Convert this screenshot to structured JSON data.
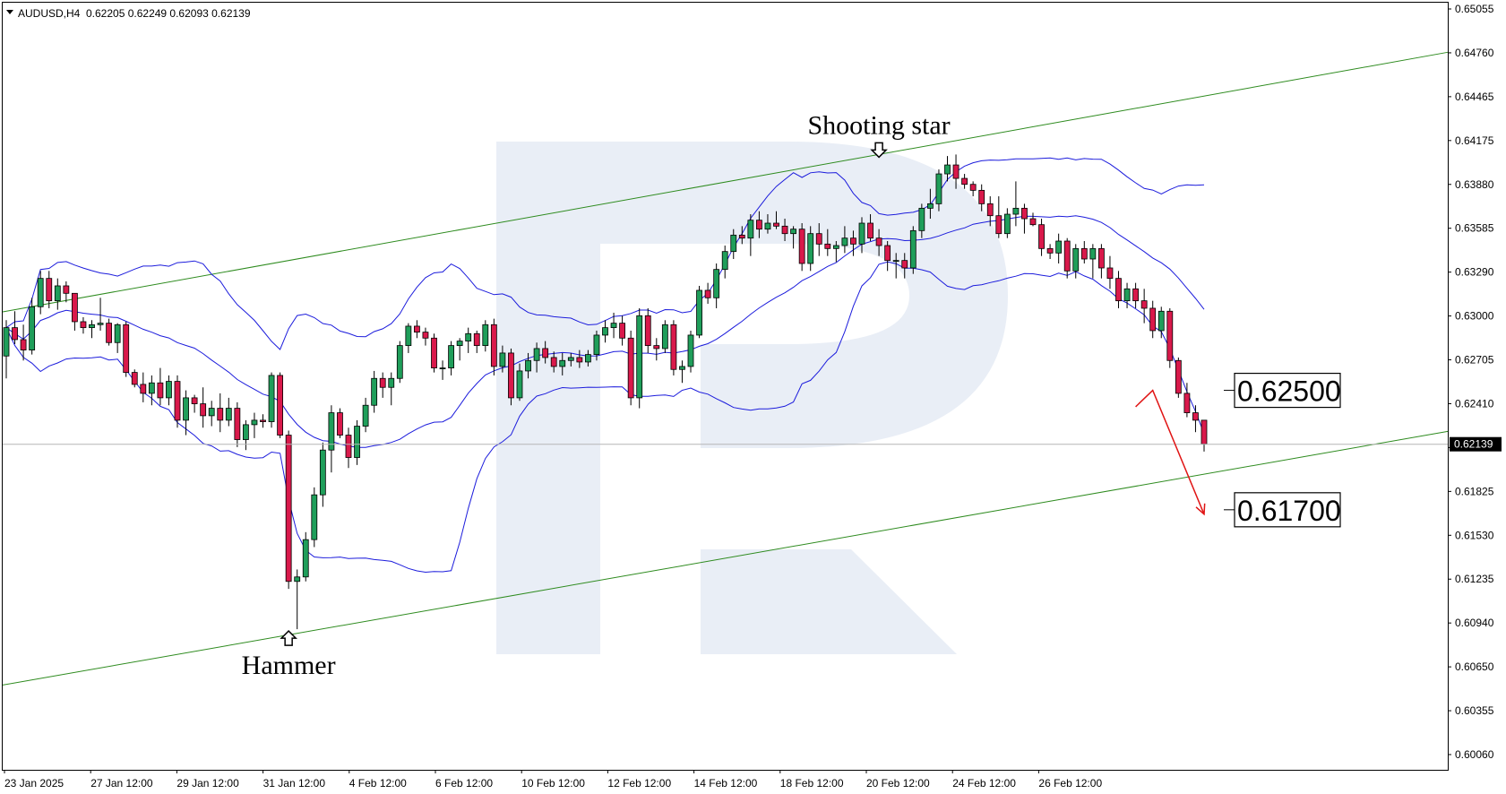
{
  "header": {
    "symbol": "AUDUSD,H4",
    "ohlc": "0.62205 0.62249 0.62093 0.62139"
  },
  "chart_data": {
    "type": "candlestick",
    "symbol": "AUDUSD",
    "timeframe": "H4",
    "ylim": [
      0.6006,
      0.65055
    ],
    "y_ticks": [
      "0.65055",
      "0.64760",
      "0.64465",
      "0.64175",
      "0.63880",
      "0.63585",
      "0.63290",
      "0.63000",
      "0.62705",
      "0.62410",
      "0.62115",
      "0.61825",
      "0.61530",
      "0.61235",
      "0.60940",
      "0.60650",
      "0.60355",
      "0.60060"
    ],
    "x_ticks": [
      "23 Jan 2025",
      "27 Jan 12:00",
      "29 Jan 12:00",
      "31 Jan 12:00",
      "4 Feb 12:00",
      "6 Feb 12:00",
      "10 Feb 12:00",
      "12 Feb 12:00",
      "14 Feb 12:00",
      "18 Feb 12:00",
      "20 Feb 12:00",
      "24 Feb 12:00",
      "26 Feb 12:00"
    ],
    "current_price": "0.62139",
    "levels": [
      {
        "label": "0.62500",
        "value": 0.625
      },
      {
        "label": "0.61700",
        "value": 0.617
      }
    ],
    "annotations": [
      {
        "text": "Shooting star",
        "x_index": 102,
        "price": 0.6405
      },
      {
        "text": "Hammer",
        "x_index": 33,
        "price": 0.609
      }
    ],
    "channel": {
      "upper": {
        "from": [
          0,
          0.6303
        ],
        "to": [
          168,
          0.6476
        ]
      },
      "lower": {
        "from": [
          0,
          0.6053
        ],
        "to": [
          168,
          0.6222
        ]
      }
    },
    "forecast_arrow": [
      [
        132,
        0.6239
      ],
      [
        134,
        0.625
      ],
      [
        140,
        0.6167
      ]
    ],
    "candles": [
      [
        0.6273,
        0.6297,
        0.6258,
        0.6292
      ],
      [
        0.6292,
        0.6303,
        0.6281,
        0.6284
      ],
      [
        0.6284,
        0.6294,
        0.627,
        0.6277
      ],
      [
        0.6277,
        0.6312,
        0.6274,
        0.6306
      ],
      [
        0.6306,
        0.633,
        0.6301,
        0.6325
      ],
      [
        0.6325,
        0.633,
        0.6305,
        0.631
      ],
      [
        0.631,
        0.6325,
        0.6304,
        0.632
      ],
      [
        0.632,
        0.6323,
        0.6309,
        0.6315
      ],
      [
        0.6315,
        0.6315,
        0.629,
        0.6296
      ],
      [
        0.6296,
        0.6299,
        0.6288,
        0.6292
      ],
      [
        0.6292,
        0.6297,
        0.6285,
        0.6294
      ],
      [
        0.6294,
        0.6312,
        0.629,
        0.6295
      ],
      [
        0.6295,
        0.6298,
        0.628,
        0.6282
      ],
      [
        0.6282,
        0.6295,
        0.6275,
        0.6294
      ],
      [
        0.6294,
        0.6296,
        0.6259,
        0.6262
      ],
      [
        0.6262,
        0.6264,
        0.6252,
        0.6254
      ],
      [
        0.6254,
        0.6262,
        0.6242,
        0.6248
      ],
      [
        0.6248,
        0.626,
        0.624,
        0.6255
      ],
      [
        0.6255,
        0.6265,
        0.624,
        0.6245
      ],
      [
        0.6245,
        0.626,
        0.624,
        0.6256
      ],
      [
        0.6256,
        0.626,
        0.6225,
        0.623
      ],
      [
        0.623,
        0.625,
        0.622,
        0.6245
      ],
      [
        0.6245,
        0.6247,
        0.6235,
        0.6241
      ],
      [
        0.6241,
        0.6252,
        0.6225,
        0.6233
      ],
      [
        0.6233,
        0.6243,
        0.6226,
        0.6238
      ],
      [
        0.6238,
        0.6248,
        0.6222,
        0.623
      ],
      [
        0.623,
        0.6245,
        0.6226,
        0.6238
      ],
      [
        0.6238,
        0.6242,
        0.6212,
        0.6217
      ],
      [
        0.6217,
        0.623,
        0.621,
        0.6227
      ],
      [
        0.6227,
        0.6235,
        0.6218,
        0.623
      ],
      [
        0.623,
        0.6234,
        0.6225,
        0.6229
      ],
      [
        0.6229,
        0.6262,
        0.6225,
        0.626
      ],
      [
        0.626,
        0.6262,
        0.6218,
        0.622
      ],
      [
        0.622,
        0.6223,
        0.6117,
        0.6122
      ],
      [
        0.6122,
        0.613,
        0.609,
        0.6125
      ],
      [
        0.6125,
        0.6155,
        0.6122,
        0.615
      ],
      [
        0.615,
        0.6185,
        0.6145,
        0.618
      ],
      [
        0.618,
        0.6215,
        0.6172,
        0.621
      ],
      [
        0.621,
        0.624,
        0.6195,
        0.6235
      ],
      [
        0.6235,
        0.6238,
        0.6218,
        0.622
      ],
      [
        0.622,
        0.6225,
        0.6198,
        0.6205
      ],
      [
        0.6205,
        0.623,
        0.62,
        0.6226
      ],
      [
        0.6226,
        0.6245,
        0.6222,
        0.624
      ],
      [
        0.624,
        0.6263,
        0.6235,
        0.6258
      ],
      [
        0.6258,
        0.6262,
        0.6245,
        0.6252
      ],
      [
        0.6252,
        0.6262,
        0.624,
        0.6258
      ],
      [
        0.6258,
        0.6283,
        0.6255,
        0.628
      ],
      [
        0.628,
        0.6295,
        0.6275,
        0.6293
      ],
      [
        0.6293,
        0.6297,
        0.6285,
        0.6289
      ],
      [
        0.6289,
        0.6292,
        0.628,
        0.6285
      ],
      [
        0.6285,
        0.6288,
        0.6262,
        0.6265
      ],
      [
        0.6265,
        0.627,
        0.6257,
        0.6265
      ],
      [
        0.6265,
        0.6283,
        0.626,
        0.628
      ],
      [
        0.628,
        0.6285,
        0.627,
        0.6283
      ],
      [
        0.6283,
        0.6292,
        0.6275,
        0.6288
      ],
      [
        0.6288,
        0.629,
        0.6275,
        0.628
      ],
      [
        0.628,
        0.6297,
        0.6276,
        0.6294
      ],
      [
        0.6294,
        0.6298,
        0.626,
        0.6266
      ],
      [
        0.6266,
        0.628,
        0.6262,
        0.6275
      ],
      [
        0.6275,
        0.6278,
        0.624,
        0.6245
      ],
      [
        0.6245,
        0.6268,
        0.6243,
        0.6263
      ],
      [
        0.6263,
        0.6275,
        0.6258,
        0.627
      ],
      [
        0.627,
        0.6282,
        0.6262,
        0.6278
      ],
      [
        0.6278,
        0.6283,
        0.6268,
        0.6272
      ],
      [
        0.6272,
        0.6276,
        0.6262,
        0.6266
      ],
      [
        0.6266,
        0.6275,
        0.626,
        0.627
      ],
      [
        0.627,
        0.6275,
        0.6266,
        0.6272
      ],
      [
        0.6272,
        0.6277,
        0.6265,
        0.6269
      ],
      [
        0.6269,
        0.6277,
        0.6266,
        0.6274
      ],
      [
        0.6274,
        0.629,
        0.627,
        0.6287
      ],
      [
        0.6287,
        0.6297,
        0.6282,
        0.6292
      ],
      [
        0.6292,
        0.6302,
        0.6285,
        0.6295
      ],
      [
        0.6295,
        0.63,
        0.628,
        0.6285
      ],
      [
        0.6285,
        0.629,
        0.624,
        0.6245
      ],
      [
        0.6245,
        0.6305,
        0.6238,
        0.63
      ],
      [
        0.63,
        0.6305,
        0.6275,
        0.628
      ],
      [
        0.628,
        0.6285,
        0.627,
        0.6278
      ],
      [
        0.6278,
        0.6297,
        0.6275,
        0.6294
      ],
      [
        0.6294,
        0.6297,
        0.626,
        0.6264
      ],
      [
        0.6264,
        0.627,
        0.6255,
        0.6266
      ],
      [
        0.6266,
        0.629,
        0.6262,
        0.6287
      ],
      [
        0.6287,
        0.632,
        0.6285,
        0.6317
      ],
      [
        0.6317,
        0.6322,
        0.6308,
        0.6312
      ],
      [
        0.6312,
        0.6335,
        0.6305,
        0.6331
      ],
      [
        0.6331,
        0.6347,
        0.6325,
        0.6343
      ],
      [
        0.6343,
        0.6358,
        0.6338,
        0.6354
      ],
      [
        0.6354,
        0.636,
        0.6348,
        0.6352
      ],
      [
        0.6352,
        0.6368,
        0.634,
        0.6364
      ],
      [
        0.6364,
        0.637,
        0.6352,
        0.6358
      ],
      [
        0.6358,
        0.6368,
        0.6355,
        0.6362
      ],
      [
        0.6362,
        0.637,
        0.6358,
        0.636
      ],
      [
        0.636,
        0.6365,
        0.635,
        0.6355
      ],
      [
        0.6355,
        0.636,
        0.6345,
        0.6358
      ],
      [
        0.6358,
        0.6362,
        0.633,
        0.6335
      ],
      [
        0.6335,
        0.636,
        0.633,
        0.6355
      ],
      [
        0.6355,
        0.6362,
        0.634,
        0.6348
      ],
      [
        0.6348,
        0.6358,
        0.634,
        0.6345
      ],
      [
        0.6345,
        0.635,
        0.6336,
        0.6347
      ],
      [
        0.6347,
        0.636,
        0.6342,
        0.6352
      ],
      [
        0.6352,
        0.6357,
        0.634,
        0.6348
      ],
      [
        0.6348,
        0.6366,
        0.6342,
        0.6362
      ],
      [
        0.6362,
        0.6368,
        0.635,
        0.6352
      ],
      [
        0.6352,
        0.6358,
        0.634,
        0.6347
      ],
      [
        0.6347,
        0.635,
        0.633,
        0.6337
      ],
      [
        0.6337,
        0.6342,
        0.6325,
        0.6337
      ],
      [
        0.6337,
        0.6342,
        0.6325,
        0.6332
      ],
      [
        0.6332,
        0.636,
        0.6328,
        0.6357
      ],
      [
        0.6357,
        0.6375,
        0.6352,
        0.6372
      ],
      [
        0.6372,
        0.6385,
        0.6365,
        0.6375
      ],
      [
        0.6375,
        0.6398,
        0.637,
        0.6395
      ],
      [
        0.6395,
        0.6407,
        0.639,
        0.6401
      ],
      [
        0.6401,
        0.6408,
        0.6385,
        0.6392
      ],
      [
        0.6392,
        0.6395,
        0.6385,
        0.6388
      ],
      [
        0.6388,
        0.639,
        0.638,
        0.6384
      ],
      [
        0.6384,
        0.6388,
        0.637,
        0.6375
      ],
      [
        0.6375,
        0.638,
        0.636,
        0.6367
      ],
      [
        0.6367,
        0.638,
        0.6352,
        0.6355
      ],
      [
        0.6355,
        0.6372,
        0.6352,
        0.6368
      ],
      [
        0.6368,
        0.639,
        0.636,
        0.6372
      ],
      [
        0.6372,
        0.6375,
        0.6355,
        0.6365
      ],
      [
        0.6365,
        0.6369,
        0.636,
        0.6361
      ],
      [
        0.6361,
        0.6365,
        0.634,
        0.6345
      ],
      [
        0.6345,
        0.6348,
        0.6338,
        0.6342
      ],
      [
        0.6342,
        0.6355,
        0.6335,
        0.635
      ],
      [
        0.635,
        0.6352,
        0.6325,
        0.633
      ],
      [
        0.633,
        0.6348,
        0.6325,
        0.6345
      ],
      [
        0.6345,
        0.635,
        0.6335,
        0.6338
      ],
      [
        0.6338,
        0.6348,
        0.6325,
        0.6345
      ],
      [
        0.6345,
        0.6348,
        0.6325,
        0.6332
      ],
      [
        0.6332,
        0.634,
        0.6318,
        0.6325
      ],
      [
        0.6325,
        0.633,
        0.6305,
        0.631
      ],
      [
        0.631,
        0.6322,
        0.6305,
        0.6318
      ],
      [
        0.6318,
        0.6322,
        0.6305,
        0.631
      ],
      [
        0.631,
        0.6318,
        0.6295,
        0.6305
      ],
      [
        0.6305,
        0.631,
        0.6285,
        0.629
      ],
      [
        0.629,
        0.6306,
        0.6285,
        0.6303
      ],
      [
        0.6303,
        0.6305,
        0.6265,
        0.627
      ],
      [
        0.627,
        0.6272,
        0.6245,
        0.6248
      ],
      [
        0.6248,
        0.6255,
        0.6232,
        0.6235
      ],
      [
        0.6235,
        0.624,
        0.6222,
        0.623
      ],
      [
        0.623,
        0.623,
        0.6209,
        0.6214
      ]
    ],
    "bollinger": {
      "period": 20,
      "deviations": 2
    }
  }
}
